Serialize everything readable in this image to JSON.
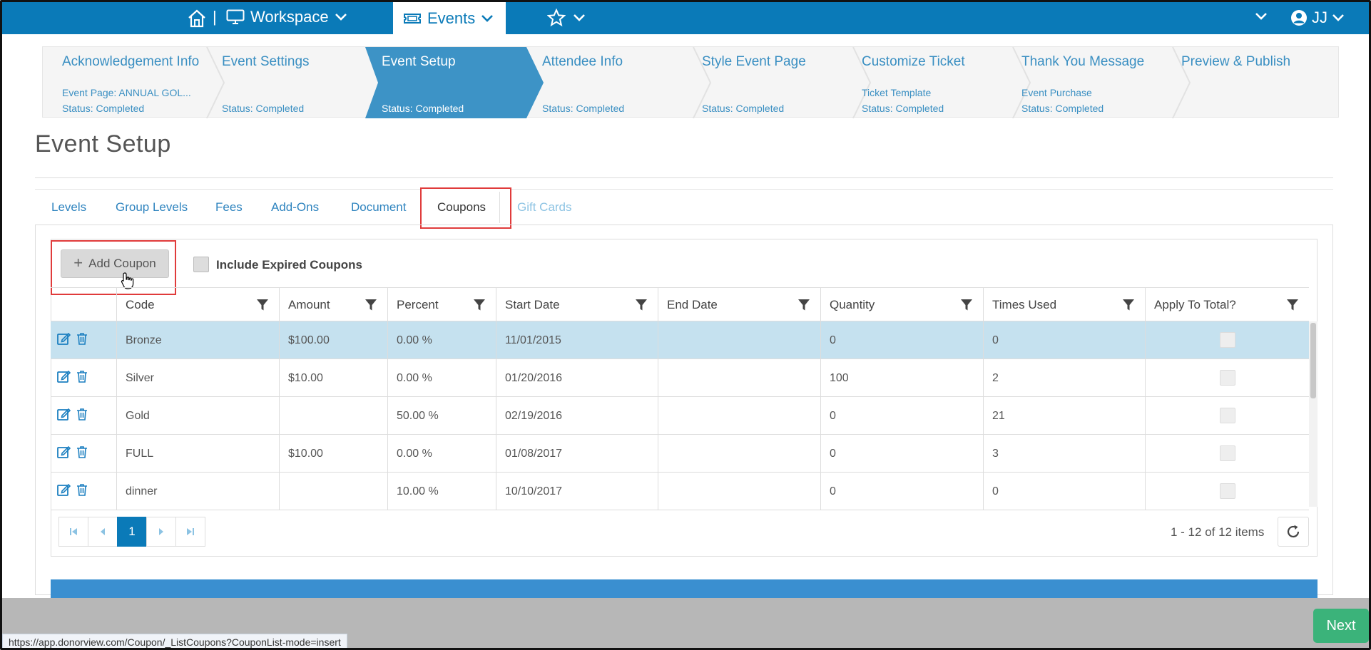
{
  "topnav": {
    "workspace_label": "Workspace",
    "events_label": "Events",
    "user_initials": "JJ",
    "separator": "|"
  },
  "wizard": {
    "steps": [
      {
        "title": "Acknowledgement Info",
        "line1": "Event Page: ANNUAL GOL...",
        "line2": "Status: Completed"
      },
      {
        "title": "Event Settings",
        "line1": "",
        "line2": "Status: Completed"
      },
      {
        "title": "Event Setup",
        "line1": "",
        "line2": "Status: Completed"
      },
      {
        "title": "Attendee Info",
        "line1": "",
        "line2": "Status: Completed"
      },
      {
        "title": "Style Event Page",
        "line1": "",
        "line2": "Status: Completed"
      },
      {
        "title": "Customize Ticket",
        "line1": "Ticket Template",
        "line2": "Status: Completed"
      },
      {
        "title": "Thank You Message",
        "line1": "Event Purchase",
        "line2": "Status: Completed"
      },
      {
        "title": "Preview & Publish",
        "line1": "",
        "line2": ""
      }
    ],
    "active_index": 2
  },
  "page": {
    "title": "Event Setup"
  },
  "subtabs": [
    {
      "label": "Levels"
    },
    {
      "label": "Group Levels"
    },
    {
      "label": "Fees"
    },
    {
      "label": "Add-Ons"
    },
    {
      "label": "Document"
    },
    {
      "label": "Coupons"
    },
    {
      "label": "Gift Cards"
    }
  ],
  "toolbar": {
    "add_label": "Add Coupon",
    "include_expired_label": "Include Expired Coupons"
  },
  "table": {
    "columns": [
      "Code",
      "Amount",
      "Percent",
      "Start Date",
      "End Date",
      "Quantity",
      "Times Used",
      "Apply To Total?"
    ],
    "rows": [
      {
        "code": "Bronze",
        "amount": "$100.00",
        "percent": "0.00 %",
        "start": "11/01/2015",
        "end": "",
        "quantity": "0",
        "used": "0"
      },
      {
        "code": "Silver",
        "amount": "$10.00",
        "percent": "0.00 %",
        "start": "01/20/2016",
        "end": "",
        "quantity": "100",
        "used": "2"
      },
      {
        "code": "Gold",
        "amount": "",
        "percent": "50.00 %",
        "start": "02/19/2016",
        "end": "",
        "quantity": "0",
        "used": "21"
      },
      {
        "code": "FULL",
        "amount": "$10.00",
        "percent": "0.00 %",
        "start": "01/08/2017",
        "end": "",
        "quantity": "0",
        "used": "3"
      },
      {
        "code": "dinner",
        "amount": "",
        "percent": "10.00 %",
        "start": "10/10/2017",
        "end": "",
        "quantity": "0",
        "used": "0"
      }
    ]
  },
  "pager": {
    "current_page": "1",
    "items_info": "1 - 12 of 12 items"
  },
  "footer": {
    "url": "https://app.donorview.com/Coupon/_ListCoupons?CouponList-mode=insert",
    "next_label": "Next"
  },
  "colors": {
    "nav_blue": "#0a7ab8",
    "active_step": "#3d93c6",
    "highlight_red": "#e03b3b",
    "next_green": "#3bb37a"
  }
}
